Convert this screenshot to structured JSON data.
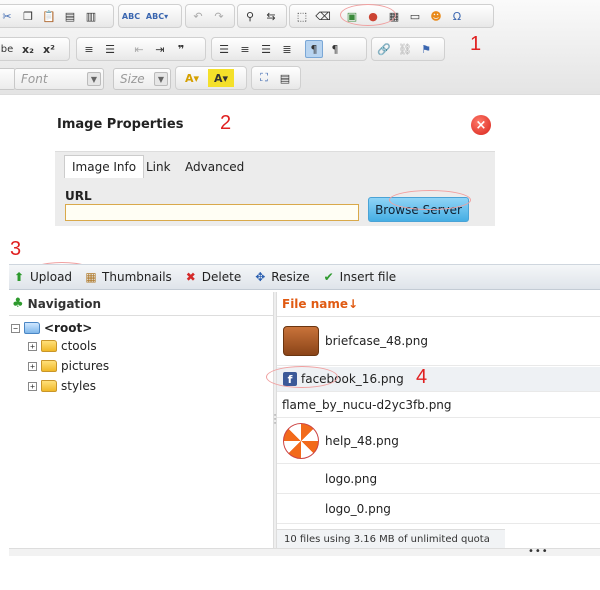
{
  "editor_toolbar": {
    "font_placeholder": "Font",
    "size_placeholder": "Size",
    "row1_buttons": [
      "cut-icon",
      "copy-icon",
      "paste-icon",
      "paste-text-icon",
      "paste-word-icon",
      "spellcheck-icon",
      "spellcheck-as-you-type-icon",
      "undo-icon",
      "redo-icon",
      "find-icon",
      "replace-icon",
      "select-all-icon",
      "remove-format-icon",
      "image-icon",
      "flash-icon",
      "table-icon",
      "horizontal-rule-icon",
      "smiley-icon",
      "special-char-icon"
    ],
    "superscript_label": "x²",
    "subscript_label": "x₂"
  },
  "annotations": {
    "n1": "1",
    "n2": "2",
    "n3": "3",
    "n4": "4"
  },
  "dialog": {
    "title": "Image Properties",
    "tabs": [
      "Image Info",
      "Link",
      "Advanced"
    ],
    "url_label": "URL",
    "url_value": "",
    "browse_label": "Browse Server"
  },
  "file_toolbar": {
    "upload": "Upload",
    "thumbnails": "Thumbnails",
    "delete": "Delete",
    "resize": "Resize",
    "insert": "Insert file"
  },
  "navigation": {
    "title": "Navigation",
    "root": "<root>",
    "folders": [
      "ctools",
      "pictures",
      "styles"
    ]
  },
  "files": {
    "column_header": "File name↓",
    "items": [
      "briefcase_48.png",
      "facebook_16.png",
      "flame_by_nucu-d2yc3fb.png",
      "help_48.png",
      "logo.png",
      "logo_0.png"
    ],
    "status": "10 files using 3.16 MB of unlimited quota"
  },
  "colors": {
    "annotation_red": "#e02020",
    "file_header_orange": "#e05a12",
    "browse_button_blue": "#45aee4"
  }
}
